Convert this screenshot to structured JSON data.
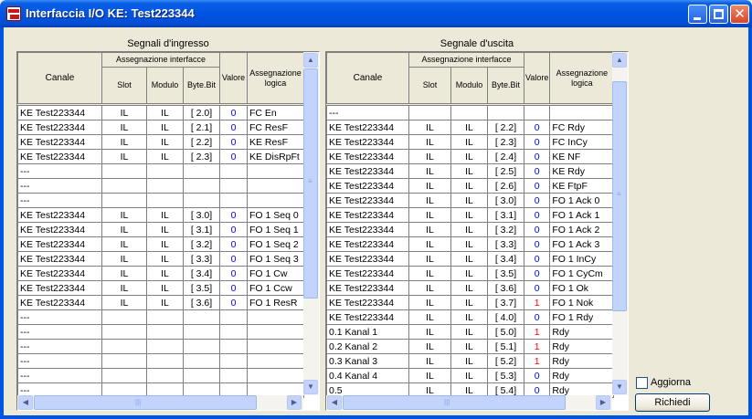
{
  "window": {
    "title": "Interfaccia I/O KE: Test223344",
    "close_glyph": "✕"
  },
  "headers": {
    "canale": "Canale",
    "assegnazione_interfacce": "Assegnazione interfacce",
    "slot": "Slot",
    "modulo": "Modulo",
    "byte_bit": "Byte.Bit",
    "valore": "Valore",
    "assegnazione_logica": "Assegnazione logica"
  },
  "input_signals": {
    "title": "Segnali d'ingresso",
    "rows": [
      {
        "canale": "KE Test223344",
        "slot": "IL",
        "modulo": "IL",
        "byte_bit": "[ 2.0]",
        "valore": "0",
        "logica": "FC En"
      },
      {
        "canale": "KE Test223344",
        "slot": "IL",
        "modulo": "IL",
        "byte_bit": "[ 2.1]",
        "valore": "0",
        "logica": "FC ResF"
      },
      {
        "canale": "KE Test223344",
        "slot": "IL",
        "modulo": "IL",
        "byte_bit": "[ 2.2]",
        "valore": "0",
        "logica": "KE ResF"
      },
      {
        "canale": "KE Test223344",
        "slot": "IL",
        "modulo": "IL",
        "byte_bit": "[ 2.3]",
        "valore": "0",
        "logica": "KE DisRpFt"
      },
      {
        "canale": "---",
        "slot": "",
        "modulo": "",
        "byte_bit": "",
        "valore": "",
        "logica": ""
      },
      {
        "canale": "---",
        "slot": "",
        "modulo": "",
        "byte_bit": "",
        "valore": "",
        "logica": ""
      },
      {
        "canale": "---",
        "slot": "",
        "modulo": "",
        "byte_bit": "",
        "valore": "",
        "logica": ""
      },
      {
        "canale": "KE Test223344",
        "slot": "IL",
        "modulo": "IL",
        "byte_bit": "[ 3.0]",
        "valore": "0",
        "logica": "FO 1 Seq 0"
      },
      {
        "canale": "KE Test223344",
        "slot": "IL",
        "modulo": "IL",
        "byte_bit": "[ 3.1]",
        "valore": "0",
        "logica": "FO 1 Seq 1"
      },
      {
        "canale": "KE Test223344",
        "slot": "IL",
        "modulo": "IL",
        "byte_bit": "[ 3.2]",
        "valore": "0",
        "logica": "FO 1 Seq 2"
      },
      {
        "canale": "KE Test223344",
        "slot": "IL",
        "modulo": "IL",
        "byte_bit": "[ 3.3]",
        "valore": "0",
        "logica": "FO 1 Seq 3"
      },
      {
        "canale": "KE Test223344",
        "slot": "IL",
        "modulo": "IL",
        "byte_bit": "[ 3.4]",
        "valore": "0",
        "logica": "FO 1 Cw"
      },
      {
        "canale": "KE Test223344",
        "slot": "IL",
        "modulo": "IL",
        "byte_bit": "[ 3.5]",
        "valore": "0",
        "logica": "FO 1 Ccw"
      },
      {
        "canale": "KE Test223344",
        "slot": "IL",
        "modulo": "IL",
        "byte_bit": "[ 3.6]",
        "valore": "0",
        "logica": "FO 1 ResR"
      },
      {
        "canale": "---",
        "slot": "",
        "modulo": "",
        "byte_bit": "",
        "valore": "",
        "logica": ""
      },
      {
        "canale": "---",
        "slot": "",
        "modulo": "",
        "byte_bit": "",
        "valore": "",
        "logica": ""
      },
      {
        "canale": "---",
        "slot": "",
        "modulo": "",
        "byte_bit": "",
        "valore": "",
        "logica": ""
      },
      {
        "canale": "---",
        "slot": "",
        "modulo": "",
        "byte_bit": "",
        "valore": "",
        "logica": ""
      },
      {
        "canale": "---",
        "slot": "",
        "modulo": "",
        "byte_bit": "",
        "valore": "",
        "logica": ""
      },
      {
        "canale": "---",
        "slot": "",
        "modulo": "",
        "byte_bit": "",
        "valore": "",
        "logica": ""
      }
    ]
  },
  "output_signals": {
    "title": "Segnale d'uscita",
    "rows": [
      {
        "canale": "---",
        "slot": "",
        "modulo": "",
        "byte_bit": "",
        "valore": "",
        "logica": ""
      },
      {
        "canale": "KE Test223344",
        "slot": "IL",
        "modulo": "IL",
        "byte_bit": "[ 2.2]",
        "valore": "0",
        "logica": "FC Rdy"
      },
      {
        "canale": "KE Test223344",
        "slot": "IL",
        "modulo": "IL",
        "byte_bit": "[ 2.3]",
        "valore": "0",
        "logica": "FC InCy"
      },
      {
        "canale": "KE Test223344",
        "slot": "IL",
        "modulo": "IL",
        "byte_bit": "[ 2.4]",
        "valore": "0",
        "logica": "KE NF"
      },
      {
        "canale": "KE Test223344",
        "slot": "IL",
        "modulo": "IL",
        "byte_bit": "[ 2.5]",
        "valore": "0",
        "logica": "KE Rdy"
      },
      {
        "canale": "KE Test223344",
        "slot": "IL",
        "modulo": "IL",
        "byte_bit": "[ 2.6]",
        "valore": "0",
        "logica": "KE FtpF"
      },
      {
        "canale": "KE Test223344",
        "slot": "IL",
        "modulo": "IL",
        "byte_bit": "[ 3.0]",
        "valore": "0",
        "logica": "FO 1 Ack 0"
      },
      {
        "canale": "KE Test223344",
        "slot": "IL",
        "modulo": "IL",
        "byte_bit": "[ 3.1]",
        "valore": "0",
        "logica": "FO 1 Ack 1"
      },
      {
        "canale": "KE Test223344",
        "slot": "IL",
        "modulo": "IL",
        "byte_bit": "[ 3.2]",
        "valore": "0",
        "logica": "FO 1 Ack 2"
      },
      {
        "canale": "KE Test223344",
        "slot": "IL",
        "modulo": "IL",
        "byte_bit": "[ 3.3]",
        "valore": "0",
        "logica": "FO 1 Ack 3"
      },
      {
        "canale": "KE Test223344",
        "slot": "IL",
        "modulo": "IL",
        "byte_bit": "[ 3.4]",
        "valore": "0",
        "logica": "FO 1 InCy"
      },
      {
        "canale": "KE Test223344",
        "slot": "IL",
        "modulo": "IL",
        "byte_bit": "[ 3.5]",
        "valore": "0",
        "logica": "FO 1 CyCm"
      },
      {
        "canale": "KE Test223344",
        "slot": "IL",
        "modulo": "IL",
        "byte_bit": "[ 3.6]",
        "valore": "0",
        "logica": "FO 1 Ok"
      },
      {
        "canale": "KE Test223344",
        "slot": "IL",
        "modulo": "IL",
        "byte_bit": "[ 3.7]",
        "valore": "1",
        "logica": "FO 1 Nok"
      },
      {
        "canale": "KE Test223344",
        "slot": "IL",
        "modulo": "IL",
        "byte_bit": "[ 4.0]",
        "valore": "0",
        "logica": "FO 1 Rdy"
      },
      {
        "canale": "0.1 Kanal 1",
        "slot": "IL",
        "modulo": "IL",
        "byte_bit": "[ 5.0]",
        "valore": "1",
        "logica": "Rdy"
      },
      {
        "canale": "0.2 Kanal 2",
        "slot": "IL",
        "modulo": "IL",
        "byte_bit": "[ 5.1]",
        "valore": "1",
        "logica": "Rdy"
      },
      {
        "canale": "0.3 Kanal 3",
        "slot": "IL",
        "modulo": "IL",
        "byte_bit": "[ 5.2]",
        "valore": "1",
        "logica": "Rdy"
      },
      {
        "canale": "0.4 Kanal 4",
        "slot": "IL",
        "modulo": "IL",
        "byte_bit": "[ 5.3]",
        "valore": "0",
        "logica": "Rdy"
      },
      {
        "canale": "0.5",
        "slot": "IL",
        "modulo": "IL",
        "byte_bit": "[ 5.4]",
        "valore": "0",
        "logica": "Rdy"
      }
    ]
  },
  "controls": {
    "aggiorna_label": "Aggiorna",
    "aggiorna_checked": false,
    "richiedi_label": "Richiedi"
  },
  "scroll": {
    "up_glyph": "▲",
    "down_glyph": "▼",
    "left_glyph": "◀",
    "right_glyph": "▶",
    "grip_v": "≡",
    "grip_h": "|||"
  },
  "colors": {
    "value_zero": "#0000ff",
    "value_one": "#ff0000",
    "titlebar": "#0054e3"
  }
}
